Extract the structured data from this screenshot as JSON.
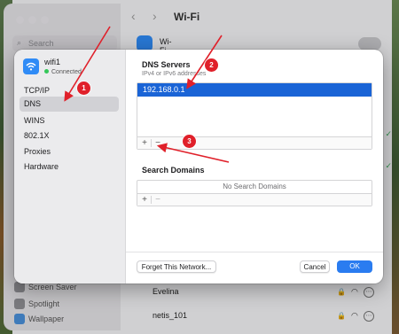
{
  "background": {
    "window_title": "Wi-Fi",
    "search_placeholder": "Search",
    "wifi_label": "Wi-Fi",
    "sidebar_items": [
      "Screen Saver",
      "Spotlight",
      "Wallpaper"
    ],
    "networks": [
      {
        "name": "Evelina",
        "locked": true
      },
      {
        "name": "netis_101",
        "locked": true
      }
    ]
  },
  "dialog": {
    "network_name": "wifi1",
    "network_status": "Connected",
    "sidebar": {
      "items": [
        "TCP/IP",
        "DNS",
        "WINS",
        "802.1X",
        "Proxies",
        "Hardware"
      ],
      "selected": "DNS"
    },
    "dns_servers": {
      "title": "DNS Servers",
      "subtitle": "IPv4 or IPv6 addresses",
      "entries": [
        "192.168.0.1"
      ],
      "add_label": "+",
      "remove_label": "−"
    },
    "search_domains": {
      "title": "Search Domains",
      "empty_text": "No Search Domains",
      "add_label": "+",
      "remove_label": "−"
    },
    "buttons": {
      "forget": "Forget This Network...",
      "cancel": "Cancel",
      "ok": "OK"
    }
  },
  "annotations": {
    "badges": [
      "1",
      "2",
      "3"
    ],
    "color": "#e0202a"
  },
  "colors": {
    "accent": "#2a7cf0",
    "selection": "#1a64d6",
    "connected": "#34c759"
  }
}
